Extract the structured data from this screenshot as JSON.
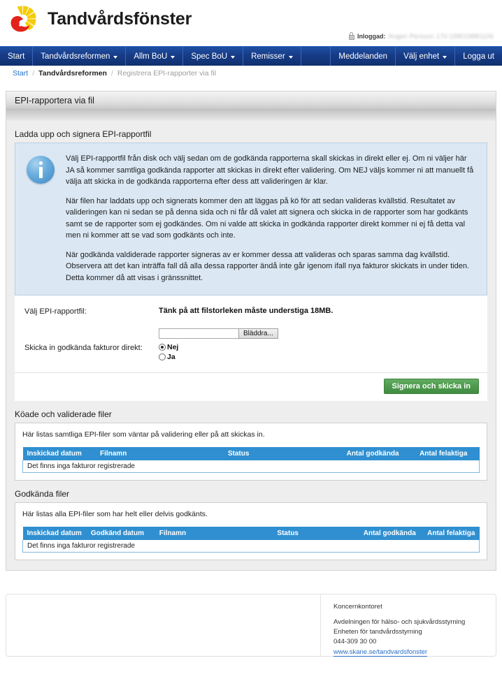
{
  "brand": {
    "title": "Tandvårdsfönster",
    "logo_icon": "region-skane-sunburst-logo"
  },
  "login": {
    "lock_icon": "lock-icon",
    "label": "Inloggad:",
    "user": "Angen Persson 170-198019881106"
  },
  "nav": {
    "left_items": [
      {
        "label": "Start",
        "caret": false
      },
      {
        "label": "Tandvårdsreformen",
        "caret": true
      },
      {
        "label": "Allm BoU",
        "caret": true
      },
      {
        "label": "Spec BoU",
        "caret": true
      },
      {
        "label": "Remisser",
        "caret": true
      }
    ],
    "right_items": [
      {
        "label": "Meddelanden",
        "caret": false
      },
      {
        "label": "Välj enhet",
        "caret": true
      },
      {
        "label": "Logga ut",
        "caret": false
      }
    ]
  },
  "breadcrumb": {
    "home": "Start",
    "parent": "Tandvårdsreformen",
    "current": "Registrera EPI-rapporter via fil",
    "separator": "/"
  },
  "page": {
    "header_title": "EPI-rapportera via fil"
  },
  "upload_section": {
    "title": "Ladda upp och signera EPI-rapportfil",
    "info_icon": "info-circle-icon",
    "paragraphs": [
      "Välj EPI-rapportfil från disk och välj sedan om de godkända rapporterna skall skickas in direkt eller ej. Om ni väljer här JA så kommer samtliga godkända rapporter att skickas in direkt efter validering. Om NEJ väljs kommer ni att manuellt få välja att skicka in de godkända rapporterna efter dess att valideringen är klar.",
      "När filen har laddats upp och signerats kommer den att läggas på kö för att sedan valideras kvällstid. Resultatet av valideringen kan ni sedan se på denna sida och ni får då valet att signera och skicka in de rapporter som har godkänts samt se de rapporter som ej godkändes. Om ni valde att skicka in godkända rapporter direkt kommer ni ej få detta val men ni kommer att se vad som godkänts och inte.",
      "När godkända valdiderade rapporter signeras av er kommer dessa att valideras och sparas samma dag kvällstid. Observera att det kan inträffa fall då alla dessa rapporter ändå inte går igenom ifall nya fakturor skickats in under tiden. Detta kommer då att visas i gränssnittet."
    ],
    "file_label": "Välj EPI-rapportfil:",
    "file_note": "Tänk på att filstorleken måste understiga 18MB.",
    "file_input_value": "",
    "file_input_placeholder": "",
    "browse_button": "Bläddra...",
    "radio_label": "Skicka in godkända fakturor direkt:",
    "radio_options": [
      {
        "label": "Nej",
        "checked": true
      },
      {
        "label": "Ja",
        "checked": false
      }
    ],
    "submit_button": "Signera och skicka in"
  },
  "queued_section": {
    "title": "Köade och validerade filer",
    "description": "Här listas samtliga EPI-filer som väntar på validering eller på att skickas in.",
    "columns": [
      "Inskickad datum",
      "Filnamn",
      "Status",
      "Antal godkända",
      "Antal felaktiga"
    ],
    "rows": [],
    "empty_text": "Det finns inga fakturor registrerade"
  },
  "approved_section": {
    "title": "Godkända filer",
    "description": "Här listas alla EPI-filer som har helt eller delvis godkänts.",
    "columns": [
      "Inskickad datum",
      "Godkänd datum",
      "Filnamn",
      "Status",
      "Antal godkända",
      "Antal felaktiga"
    ],
    "rows": [],
    "empty_text": "Det finns inga fakturor registrerade"
  },
  "footer": {
    "org": "Koncernkontoret",
    "line1": "Avdelningen för hälso- och sjukvårdsstyrning",
    "line2": "Enheten för tandvårdsstyrning",
    "phone": "044-309 30 00",
    "link": "www.skane.se/tandvardsfonster"
  },
  "colors": {
    "nav_blue": "#173c87",
    "table_header_blue": "#2f8fd0",
    "info_bg": "#dbe8f4",
    "button_green": "#4d9a4d",
    "link_blue": "#2b6fc4",
    "logo_yellow": "#f5cc0a",
    "logo_red": "#e2231a"
  }
}
